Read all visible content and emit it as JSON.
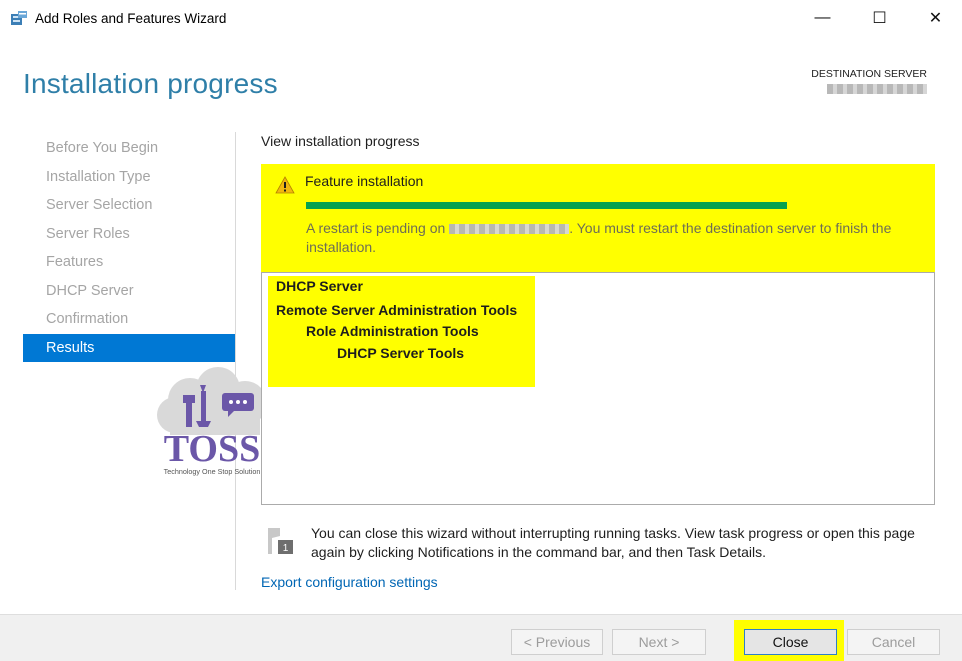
{
  "window": {
    "title": "Add Roles and Features Wizard",
    "controls": {
      "minimize": "—",
      "maximize": "☐",
      "close": "✕"
    }
  },
  "header": {
    "page_title": "Installation progress",
    "destination_label": "DESTINATION SERVER"
  },
  "nav": {
    "items": [
      {
        "label": "Before You Begin",
        "active": false
      },
      {
        "label": "Installation Type",
        "active": false
      },
      {
        "label": "Server Selection",
        "active": false
      },
      {
        "label": "Server Roles",
        "active": false
      },
      {
        "label": "Features",
        "active": false
      },
      {
        "label": "DHCP Server",
        "active": false
      },
      {
        "label": "Confirmation",
        "active": false
      },
      {
        "label": "Results",
        "active": true
      }
    ]
  },
  "logo": {
    "text": "TOSS",
    "tagline": "Technology One Stop Solution"
  },
  "main": {
    "section_label": "View installation progress",
    "progress": {
      "title": "Feature installation",
      "fraction_complete": 1.0,
      "message_before": "A restart is pending on ",
      "message_after": ". You must restart the destination server to finish the installation."
    },
    "results": [
      {
        "label": "DHCP Server",
        "level": 0
      },
      {
        "label": "Remote Server Administration Tools",
        "level": 0
      },
      {
        "label": "Role Administration Tools",
        "level": 1
      },
      {
        "label": "DHCP Server Tools",
        "level": 2
      }
    ],
    "info_text": "You can close this wizard without interrupting running tasks. View task progress or open this page again by clicking Notifications in the command bar, and then Task Details.",
    "info_icon_badge": "1",
    "export_link": "Export configuration settings"
  },
  "footer": {
    "previous": "< Previous",
    "next": "Next >",
    "close": "Close",
    "cancel": "Cancel"
  },
  "colors": {
    "accent": "#2f7fa8",
    "nav_active": "#0078d4",
    "highlight": "#ffff00",
    "progress": "#06a14f",
    "link": "#0066b4"
  }
}
